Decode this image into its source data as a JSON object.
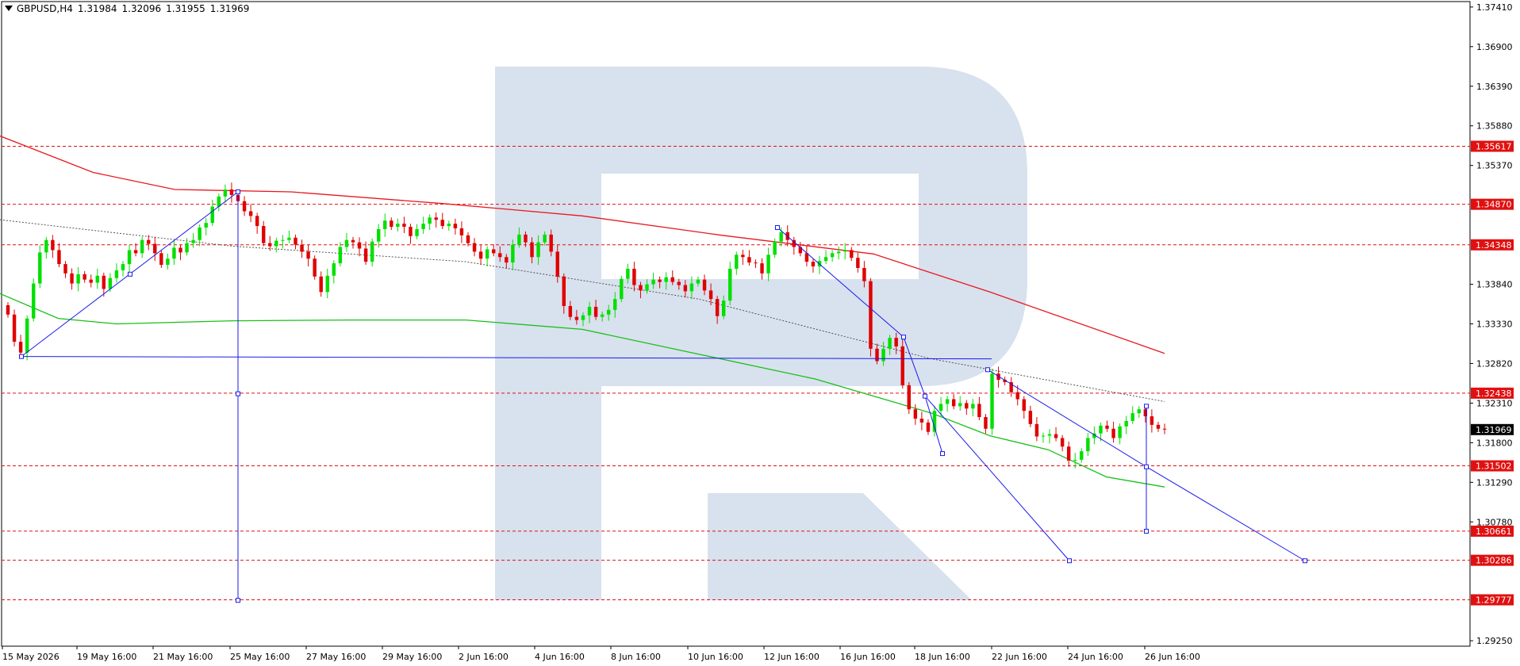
{
  "header": {
    "symbol": "GBPUSD,H4",
    "open": "1.31984",
    "high": "1.32096",
    "low": "1.31955",
    "close": "1.31969"
  },
  "colors": {
    "bull": "#00e000",
    "bear": "#e00000",
    "ma_slow": "#e8181e",
    "ma_fast": "#18c018",
    "ma_dotted": "#555555",
    "drawing": "#1a1aee",
    "level": "#e01010",
    "watermark": "#d8e1ee",
    "current_price_bg": "#000000",
    "grid_border": "#000000"
  },
  "chart_data": {
    "type": "candlestick",
    "title": "GBPUSD,H4",
    "y_axis_ticks": [
      "1.37410",
      "1.36900",
      "1.36390",
      "1.35880",
      "1.35370",
      "1.34870",
      "1.34348",
      "1.33840",
      "1.33330",
      "1.32820",
      "1.32310",
      "1.31800",
      "1.31290",
      "1.30780",
      "1.30661",
      "1.30286",
      "1.29777",
      "1.29250"
    ],
    "y_axis_tick_values": [
      1.3741,
      1.369,
      1.3639,
      1.3588,
      1.3537,
      1.3487,
      1.3434,
      1.3384,
      1.3333,
      1.3282,
      1.3231,
      1.318,
      1.3129,
      1.3078,
      1.30661,
      1.30286,
      1.29777,
      1.2925
    ],
    "ylim": [
      1.2918,
      1.3748
    ],
    "x_axis_labels": [
      "15 May 2026",
      "19 May 16:00",
      "21 May 16:00",
      "25 May 16:00",
      "27 May 16:00",
      "29 May 16:00",
      "2 Jun 16:00",
      "4 Jun 16:00",
      "8 Jun 16:00",
      "10 Jun 16:00",
      "12 Jun 16:00",
      "16 Jun 16:00",
      "18 Jun 16:00",
      "22 Jun 16:00",
      "24 Jun 16:00",
      "26 Jun 16:00"
    ],
    "current_price": "1.31969",
    "levels": [
      {
        "label": "1.35617",
        "value": 1.35617
      },
      {
        "label": "1.34870",
        "value": 1.3487
      },
      {
        "label": "1.34348",
        "value": 1.34348
      },
      {
        "label": "1.32438",
        "value": 1.32438
      },
      {
        "label": "1.31502",
        "value": 1.31502
      },
      {
        "label": "1.30661",
        "value": 1.30661
      },
      {
        "label": "1.30286",
        "value": 1.30286
      },
      {
        "label": "1.29777",
        "value": 1.29777
      }
    ],
    "close_series": [
      1.3345,
      1.331,
      1.3296,
      1.334,
      1.3385,
      1.3425,
      1.3441,
      1.3428,
      1.341,
      1.3398,
      1.3385,
      1.3397,
      1.339,
      1.3386,
      1.3395,
      1.3378,
      1.3392,
      1.3402,
      1.341,
      1.3428,
      1.3424,
      1.3441,
      1.3436,
      1.3424,
      1.3409,
      1.3417,
      1.3431,
      1.3425,
      1.3437,
      1.3441,
      1.3457,
      1.3463,
      1.3484,
      1.3497,
      1.3506,
      1.3499,
      1.3491,
      1.3478,
      1.3472,
      1.3459,
      1.3437,
      1.3433,
      1.344,
      1.3441,
      1.3444,
      1.3435,
      1.3426,
      1.3417,
      1.3394,
      1.3374,
      1.3395,
      1.3411,
      1.3432,
      1.3441,
      1.3438,
      1.343,
      1.3413,
      1.3439,
      1.3455,
      1.3466,
      1.3458,
      1.3462,
      1.3458,
      1.3446,
      1.3455,
      1.3462,
      1.347,
      1.3467,
      1.3459,
      1.3462,
      1.3456,
      1.3447,
      1.3437,
      1.3426,
      1.3417,
      1.3429,
      1.3424,
      1.3419,
      1.3412,
      1.3435,
      1.3448,
      1.3438,
      1.3419,
      1.3438,
      1.3448,
      1.3426,
      1.3394,
      1.3356,
      1.3342,
      1.3338,
      1.3344,
      1.3355,
      1.3342,
      1.3345,
      1.3351,
      1.3365,
      1.3391,
      1.3404,
      1.3383,
      1.3376,
      1.3384,
      1.339,
      1.3387,
      1.3393,
      1.3387,
      1.3383,
      1.3375,
      1.3385,
      1.339,
      1.3376,
      1.3365,
      1.3343,
      1.3363,
      1.3404,
      1.3422,
      1.3419,
      1.3412,
      1.3411,
      1.3398,
      1.3422,
      1.3439,
      1.3451,
      1.3441,
      1.3432,
      1.3424,
      1.3413,
      1.3407,
      1.3414,
      1.3419,
      1.3424,
      1.3426,
      1.3428,
      1.3418,
      1.3405,
      1.3388,
      1.3301,
      1.3285,
      1.3301,
      1.3315,
      1.3304,
      1.3254,
      1.3223,
      1.3211,
      1.3206,
      1.3194,
      1.3221,
      1.323,
      1.3236,
      1.3227,
      1.3231,
      1.3224,
      1.323,
      1.3213,
      1.3198,
      1.3269,
      1.3261,
      1.3258,
      1.3245,
      1.3236,
      1.3221,
      1.3204,
      1.3188,
      1.3189,
      1.3191,
      1.3186,
      1.3175,
      1.3157,
      1.3158,
      1.3169,
      1.3186,
      1.3192,
      1.3202,
      1.3198,
      1.3186,
      1.3201,
      1.3208,
      1.3218,
      1.3223,
      1.3214,
      1.3203,
      1.3198,
      1.3197
    ],
    "series": [
      {
        "name": "",
        "type": "moving-average",
        "color_key": "ma_slow",
        "x_frac": [
          0.0,
          0.08,
          0.15,
          0.25,
          0.38,
          0.5,
          0.62,
          0.75,
          0.85,
          1.0
        ],
        "values": [
          1.3575,
          1.3528,
          1.3506,
          1.3503,
          1.3488,
          1.3472,
          1.3447,
          1.3423,
          1.3374,
          1.3295
        ]
      },
      {
        "name": "",
        "type": "moving-average",
        "color_key": "ma_fast",
        "x_frac": [
          0.0,
          0.05,
          0.1,
          0.2,
          0.3,
          0.4,
          0.5,
          0.6,
          0.7,
          0.8,
          0.85,
          0.9,
          0.95,
          1.0
        ],
        "values": [
          1.3372,
          1.334,
          1.3333,
          1.3337,
          1.3338,
          1.3338,
          1.3326,
          1.3294,
          1.3262,
          1.3218,
          1.3189,
          1.3171,
          1.3136,
          1.3123
        ]
      },
      {
        "name": "",
        "type": "dotted-ma",
        "color_key": "ma_dotted",
        "x_frac": [
          0.0,
          0.2,
          0.4,
          0.6,
          0.8,
          1.0
        ],
        "values": [
          1.3467,
          1.3433,
          1.3413,
          1.3365,
          1.3288,
          1.3233
        ]
      }
    ],
    "grid": false
  }
}
